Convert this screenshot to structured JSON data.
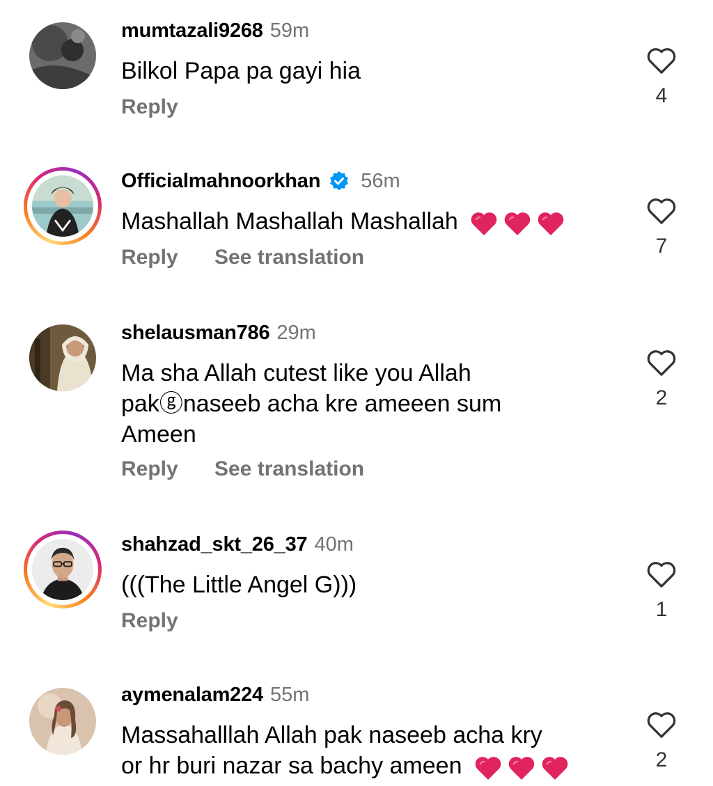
{
  "colors": {
    "text": "#000000",
    "muted": "#737373",
    "verified": "#0095f6",
    "heart_red": "#e0245e"
  },
  "comments": [
    {
      "username": "mumtazali9268",
      "time": "59m",
      "text": [
        "Bilkol Papa pa gayi hia"
      ],
      "actions": [
        "Reply"
      ],
      "likes": "4"
    },
    {
      "username": "Officialmahnoorkhan",
      "verified": true,
      "time": "56m",
      "text": [
        "Mashallah Mashallah Mashallah"
      ],
      "hearts": 3,
      "actions": [
        "Reply",
        "See translation"
      ],
      "likes": "7"
    },
    {
      "username": "shelausman786",
      "time": "29m",
      "text": [
        "Ma sha Allah cutest like you Allah",
        "pakⓖnaseeb acha kre ameeen sum",
        "Ameen"
      ],
      "actions": [
        "Reply",
        "See translation"
      ],
      "likes": "2"
    },
    {
      "username": "shahzad_skt_26_37",
      "time": "40m",
      "text": [
        "(((The Little Angel G)))"
      ],
      "actions": [
        "Reply"
      ],
      "likes": "1"
    },
    {
      "username": "aymenalam224",
      "time": "55m",
      "text": [
        "Massahalllah Allah pak naseeb acha kry",
        "or hr buri nazar sa bachy ameen"
      ],
      "hearts": 3,
      "likes": "2"
    }
  ]
}
